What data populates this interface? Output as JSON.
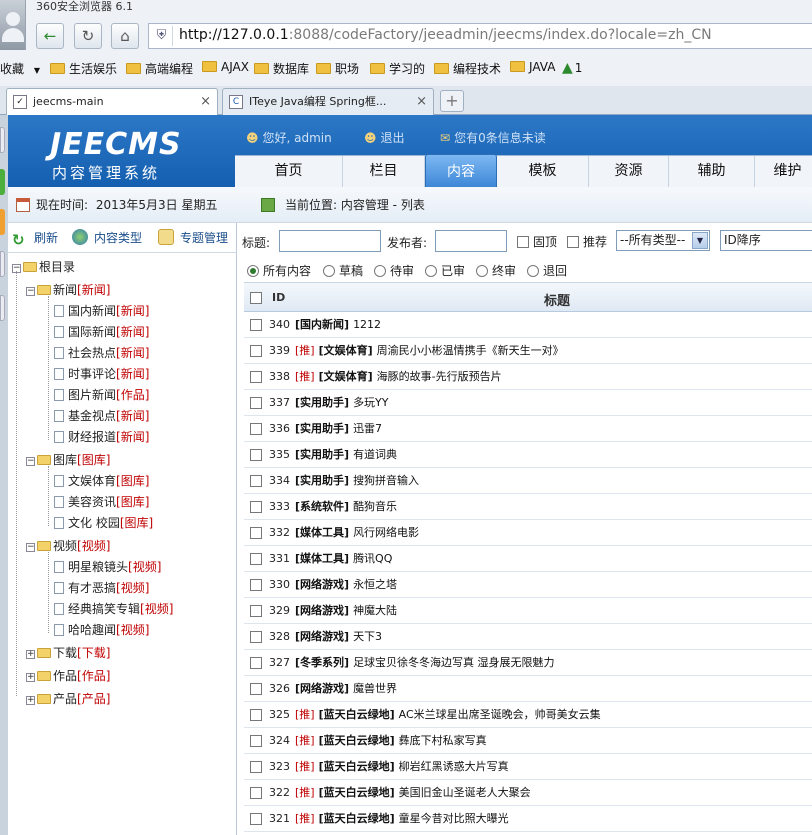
{
  "browser": {
    "title": "360安全浏览器 6.1",
    "url_host": "http://127.0.0.1",
    "url_rest": ":8088/codeFactory/jeeadmin/jeecms/index.do?locale=zh_CN",
    "favorites_label": "收藏",
    "bookmarks": [
      "生活娱乐",
      "高端编程",
      "AJAX",
      "数据库",
      "职场",
      "学习的",
      "编程技术",
      "JAVA",
      "1"
    ],
    "tabs": [
      {
        "label": "jeecms-main",
        "active": true
      },
      {
        "label": "ITeye Java编程 Spring框...",
        "active": false
      }
    ]
  },
  "header": {
    "logo": "JEECMS",
    "logo_sub": "内容管理系统",
    "greeting": "您好, admin",
    "logout": "退出",
    "messages": "您有0条信息未读",
    "nav": [
      "首页",
      "栏目",
      "内容",
      "模板",
      "资源",
      "辅助",
      "维护"
    ],
    "nav_active": "内容"
  },
  "left": {
    "time_label": "现在时间: ",
    "time_value": "2013年5月3日 星期五",
    "tools": [
      "刷新",
      "内容类型",
      "专题管理"
    ],
    "tree_root": "根目录",
    "tree": [
      {
        "label": "新闻",
        "tag": "[新闻]",
        "children": [
          {
            "label": "国内新闻",
            "tag": "[新闻]"
          },
          {
            "label": "国际新闻",
            "tag": "[新闻]"
          },
          {
            "label": "社会热点",
            "tag": "[新闻]"
          },
          {
            "label": "时事评论",
            "tag": "[新闻]"
          },
          {
            "label": "图片新闻",
            "tag": "[作品]"
          },
          {
            "label": "基金视点",
            "tag": "[新闻]"
          },
          {
            "label": "财经报道",
            "tag": "[新闻]"
          }
        ]
      },
      {
        "label": "图库",
        "tag": "[图库]",
        "children": [
          {
            "label": "文娱体育",
            "tag": "[图库]"
          },
          {
            "label": "美容资讯",
            "tag": "[图库]"
          },
          {
            "label": "文化 校园",
            "tag": "[图库]"
          }
        ]
      },
      {
        "label": "视频",
        "tag": "[视频]",
        "children": [
          {
            "label": "明星粮镜头",
            "tag": "[视频]"
          },
          {
            "label": "有才恶搞",
            "tag": "[视频]"
          },
          {
            "label": "经典搞笑专辑",
            "tag": "[视频]"
          },
          {
            "label": "哈哈趣闻",
            "tag": "[视频]"
          }
        ]
      },
      {
        "label": "下载",
        "tag": "[下载]",
        "children": []
      },
      {
        "label": "作品",
        "tag": "[作品]",
        "children": []
      },
      {
        "label": "产品",
        "tag": "[产品]",
        "children": []
      }
    ]
  },
  "content": {
    "breadcrumb": "当前位置: 内容管理 - 列表",
    "filters": {
      "title_label": "标题:",
      "publisher_label": "发布者:",
      "top_label": "固顶",
      "recommend_label": "推荐",
      "type_select": "--所有类型--",
      "sort_select": "ID降序"
    },
    "statuses": [
      "所有内容",
      "草稿",
      "待审",
      "已审",
      "终审",
      "退回"
    ],
    "status_selected": "所有内容",
    "columns": {
      "id": "ID",
      "title": "标题"
    },
    "rows": [
      {
        "id": "340",
        "rec": "",
        "cat": "[国内新闻]",
        "title": "1212"
      },
      {
        "id": "339",
        "rec": "[推]",
        "cat": "[文娱体育]",
        "title": "周渝民小小彬温情携手《新天生一对》"
      },
      {
        "id": "338",
        "rec": "[推]",
        "cat": "[文娱体育]",
        "title": "海豚的故事-先行版预告片"
      },
      {
        "id": "337",
        "rec": "",
        "cat": "[实用助手]",
        "title": "多玩YY"
      },
      {
        "id": "336",
        "rec": "",
        "cat": "[实用助手]",
        "title": "迅雷7"
      },
      {
        "id": "335",
        "rec": "",
        "cat": "[实用助手]",
        "title": "有道词典"
      },
      {
        "id": "334",
        "rec": "",
        "cat": "[实用助手]",
        "title": "搜狗拼音输入"
      },
      {
        "id": "333",
        "rec": "",
        "cat": "[系统软件]",
        "title": "酷狗音乐"
      },
      {
        "id": "332",
        "rec": "",
        "cat": "[媒体工具]",
        "title": "风行网络电影"
      },
      {
        "id": "331",
        "rec": "",
        "cat": "[媒体工具]",
        "title": "腾讯QQ"
      },
      {
        "id": "330",
        "rec": "",
        "cat": "[网络游戏]",
        "title": "永恒之塔"
      },
      {
        "id": "329",
        "rec": "",
        "cat": "[网络游戏]",
        "title": "神魔大陆"
      },
      {
        "id": "328",
        "rec": "",
        "cat": "[网络游戏]",
        "title": "天下3"
      },
      {
        "id": "327",
        "rec": "",
        "cat": "[冬季系列]",
        "title": "足球宝贝徐冬冬海边写真 湿身展无限魅力"
      },
      {
        "id": "326",
        "rec": "",
        "cat": "[网络游戏]",
        "title": "魔兽世界"
      },
      {
        "id": "325",
        "rec": "[推]",
        "cat": "[蓝天白云绿地]",
        "title": "AC米兰球星出席圣诞晚会，帅哥美女云集"
      },
      {
        "id": "324",
        "rec": "[推]",
        "cat": "[蓝天白云绿地]",
        "title": "彝底下村私家写真"
      },
      {
        "id": "323",
        "rec": "[推]",
        "cat": "[蓝天白云绿地]",
        "title": "柳岩红黑诱惑大片写真"
      },
      {
        "id": "322",
        "rec": "[推]",
        "cat": "[蓝天白云绿地]",
        "title": "美国旧金山圣诞老人大聚会"
      },
      {
        "id": "321",
        "rec": "[推]",
        "cat": "[蓝天白云绿地]",
        "title": "童星今昔对比照大曝光"
      }
    ]
  }
}
